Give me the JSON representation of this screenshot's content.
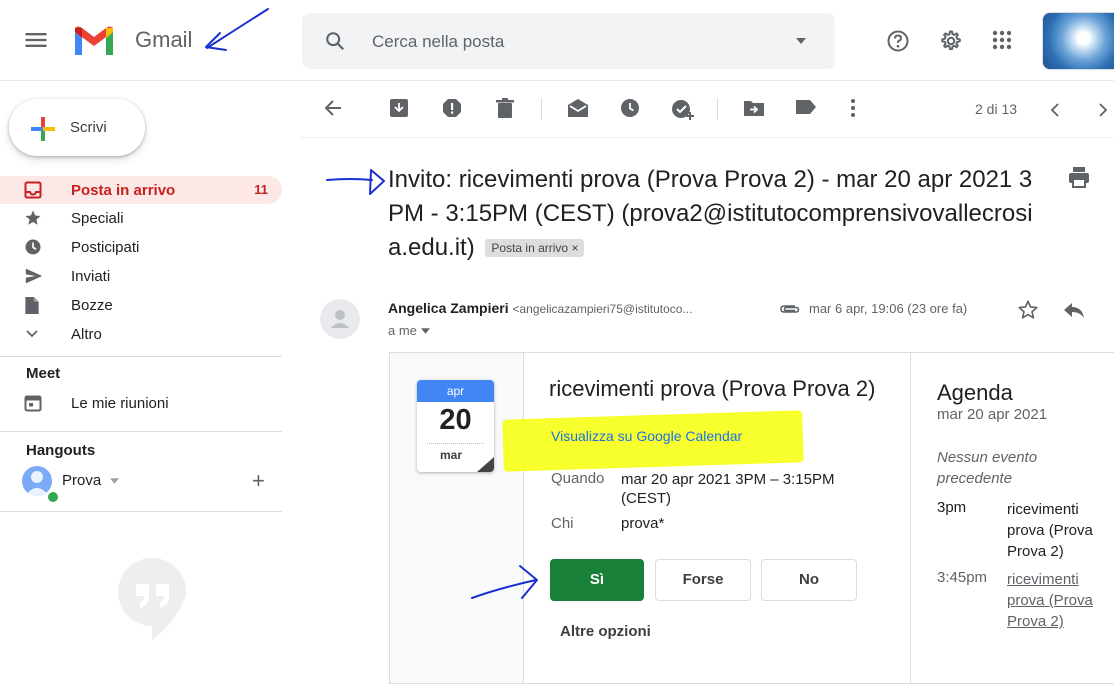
{
  "header": {
    "brand": "Gmail",
    "search_placeholder": "Cerca nella posta"
  },
  "sidebar": {
    "compose_label": "Scrivi",
    "items": [
      {
        "label": "Posta in arrivo",
        "count": "11",
        "icon": "inbox-icon"
      },
      {
        "label": "Speciali",
        "icon": "star-icon"
      },
      {
        "label": "Posticipati",
        "icon": "clock-icon"
      },
      {
        "label": "Inviati",
        "icon": "send-icon"
      },
      {
        "label": "Bozze",
        "icon": "draft-icon"
      },
      {
        "label": "Altro",
        "icon": "chevron-down-icon"
      }
    ],
    "meet_title": "Meet",
    "meet_item": "Le mie riunioni",
    "hangouts_title": "Hangouts",
    "hangouts_user": "Prova"
  },
  "toolbar": {
    "page_count": "2 di 13"
  },
  "message": {
    "subject": "Invito: ricevimenti prova (Prova Prova 2) - mar 20 apr 2021 3PM - 3:15PM (CEST) (prova2@istitutocomprensivovallecrosia.edu.it)",
    "label_chip": "Posta in arrivo",
    "label_chip_close": "×",
    "sender_name": "Angelica Zampieri",
    "sender_email": "<angelicazampieri75@istitutoco...",
    "date": "mar 6 apr, 19:06 (23 ore fa)",
    "to": "a me"
  },
  "invite": {
    "month": "apr",
    "day": "20",
    "weekday": "mar",
    "title": "ricevimenti prova (Prova Prova 2)",
    "calendar_link": "Visualizza su Google Calendar",
    "when_label": "Quando",
    "when_value": "mar 20 apr 2021 3PM – 3:15PM (CEST)",
    "who_label": "Chi",
    "who_value": "prova*",
    "rsvp_yes": "Sì",
    "rsvp_maybe": "Forse",
    "rsvp_no": "No",
    "more_options": "Altre opzioni"
  },
  "agenda": {
    "title": "Agenda",
    "date": "mar 20 apr 2021",
    "no_previous": "Nessun evento precedente",
    "events": [
      {
        "time": "3pm",
        "title": "ricevimenti prova (Prova Prova 2)"
      },
      {
        "time": "3:45pm",
        "title": "ricevimenti prova (Prova Prova 2)"
      }
    ]
  },
  "colors": {
    "accent_red": "#c5221f",
    "inbox_highlight": "#fce8e6",
    "rsvp_green": "#188038",
    "link_blue": "#1a73e8",
    "annotation_blue": "#1a2fd0",
    "highlighter_yellow": "#f6ff1a"
  }
}
